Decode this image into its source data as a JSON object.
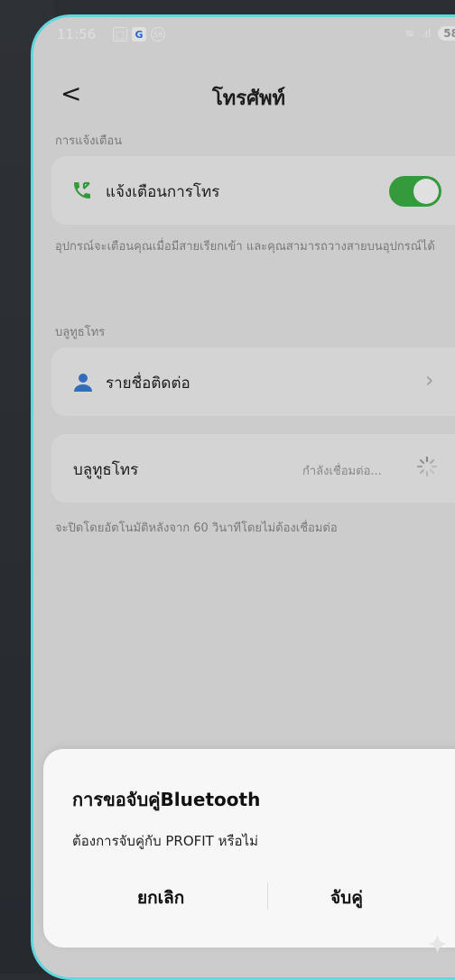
{
  "status_bar": {
    "time": "11:56",
    "icon_g": "G",
    "icon_badge": "58",
    "battery": "58",
    "signal": ".ıl",
    "wifi": "≋"
  },
  "header": {
    "back": "<",
    "title": "โทรศัพท์"
  },
  "call_notification": {
    "section_label": "การแจ้งเตือน",
    "row_label": "แจ้งเตือนการโทร",
    "toggle_on": true,
    "description": "อุปกรณ์จะเตือนคุณเมื่อมีสายเรียกเข้า และคุณสามารถวางสายบนอุปกรณ์ได้"
  },
  "bluetooth_call": {
    "section_label": "บลูทูธโทร",
    "contacts_label": "รายชื่อติดต่อ",
    "bt_label": "บลูทูธโทร",
    "bt_status": "กำลังเชื่อมต่อ...",
    "auto_close_note": "จะปิดโดยอัตโนมัติหลังจาก 60 วินาทีโดยไม่ต้องเชื่อมต่อ"
  },
  "dialog": {
    "title": "การขอจับคู่Bluetooth",
    "message": "ต้องการจับคู่กับ PROFIT หรือไม่",
    "cancel_label": "ยกเลิก",
    "pair_label": "จับคู่"
  },
  "colors": {
    "accent_green": "#3cb045",
    "frame_cyan": "#63d6dd",
    "icon_blue": "#3a7bd5"
  }
}
